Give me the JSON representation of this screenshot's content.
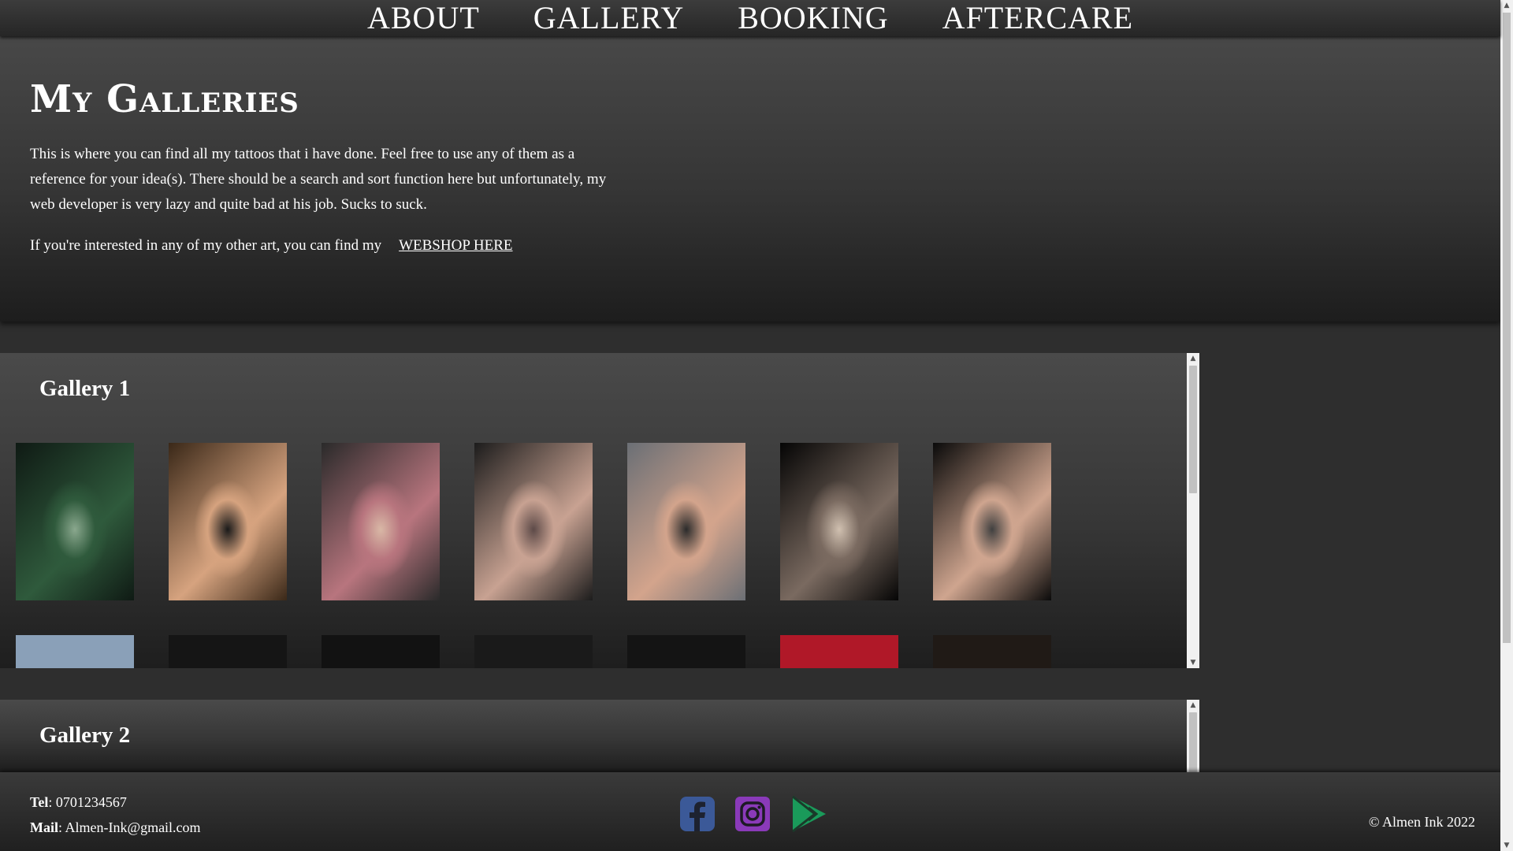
{
  "nav": {
    "items": [
      "ABOUT",
      "GALLERY",
      "BOOKING",
      "AFTERCARE"
    ]
  },
  "hero": {
    "title": "My Galleries",
    "paragraph1": "This is where you can find all my tattoos that i have done. Feel free to use any of them as a reference for your idea(s). There should be a search and sort function here but unfortunately, my web developer is very lazy and quite bad at his job. Sucks to suck.",
    "paragraph2": "If you're interested in any of my other art, you can find my",
    "webshop_link": "WEBSHOP HERE"
  },
  "galleries": [
    {
      "title": "Gallery 1",
      "row1": [
        {
          "subject": "forearm-cover-up",
          "colors": [
            "#0f1a14",
            "#2f5a3c",
            "#8aa88e"
          ]
        },
        {
          "subject": "butterflies-on-arm",
          "colors": [
            "#3a2818",
            "#d6a37f",
            "#1a1a1a"
          ]
        },
        {
          "subject": "eagle-sleeve",
          "colors": [
            "#2a2a2a",
            "#b8757e",
            "#d9b8a6"
          ]
        },
        {
          "subject": "chest-piece-skull",
          "colors": [
            "#1c1c1c",
            "#c8a292",
            "#5d4a48"
          ]
        },
        {
          "subject": "chest-piece-shoulder",
          "colors": [
            "#6b6f75",
            "#d3a48c",
            "#2b2b2b"
          ]
        },
        {
          "subject": "harley-quinn-portrait",
          "colors": [
            "#050505",
            "#7a6a60",
            "#d0c0b0"
          ]
        },
        {
          "subject": "harley-quinn-small",
          "colors": [
            "#0a0a0a",
            "#cfa58f",
            "#404040"
          ]
        }
      ],
      "row2": [
        {
          "subject": "arm-light",
          "colors": [
            "#8aa0b8",
            "#d8b090"
          ]
        },
        {
          "subject": "arm-dark",
          "colors": [
            "#151515",
            "#a08070"
          ]
        },
        {
          "subject": "shoulder-dark",
          "colors": [
            "#121212",
            "#b08a78"
          ]
        },
        {
          "subject": "shoulder-dark-2",
          "colors": [
            "#1a1a1a",
            "#a88878"
          ]
        },
        {
          "subject": "arm-dark-2",
          "colors": [
            "#141414",
            "#b69080"
          ]
        },
        {
          "subject": "red-hair",
          "colors": [
            "#b01828",
            "#ff4050"
          ]
        },
        {
          "subject": "hand",
          "colors": [
            "#201a16",
            "#e0a080"
          ]
        }
      ]
    },
    {
      "title": "Gallery 2"
    }
  ],
  "footer": {
    "tel_label": "Tel",
    "tel_value": ": 0701234567",
    "mail_label": "Mail",
    "mail_value": ": Almen-Ink@gmail.com",
    "copyright": "© Almen Ink 2022",
    "social": [
      {
        "name": "facebook-icon",
        "color": "#3b5998"
      },
      {
        "name": "instagram-icon",
        "color": "#8a3ab9"
      },
      {
        "name": "google-play-icon",
        "color": "#1a9a5a"
      }
    ]
  }
}
